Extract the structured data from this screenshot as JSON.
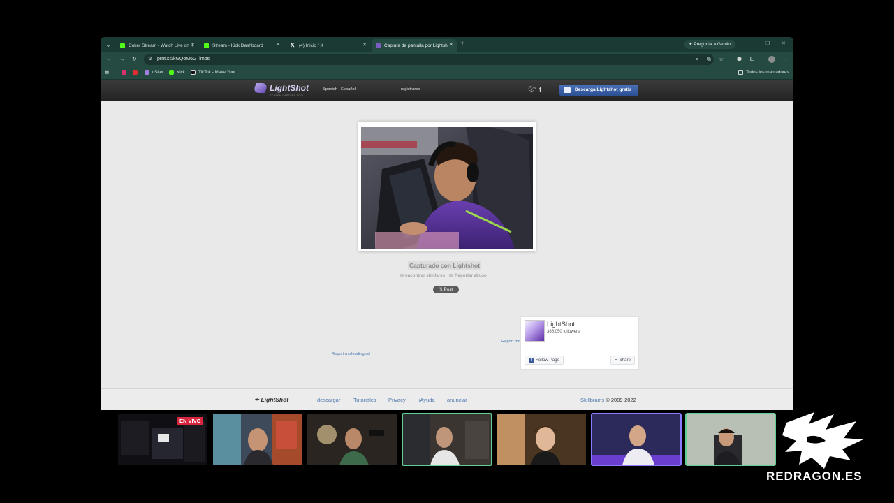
{
  "browser": {
    "tabs": [
      {
        "label": "Coker Stream - Watch Live on K",
        "favicon": "kick-icon",
        "active": false
      },
      {
        "label": "Stream - Kick Dashboard",
        "favicon": "kick-icon",
        "active": false
      },
      {
        "label": "(4) Inicio / X",
        "favicon": "x-icon",
        "active": false
      },
      {
        "label": "Captura de pantalla por Lightsh",
        "favicon": "lightshot-icon",
        "active": true
      }
    ],
    "gemini_label": "Pregunta a Gemini",
    "url": "prnt.sc/kGQoM6G_lmbs",
    "bookmarks": [
      "",
      "",
      "cSker",
      "Kick",
      "TikTok - Make Your..."
    ],
    "bookmarks_folder": "Todos los marcadores"
  },
  "lightshot": {
    "logo_text": "LightShot",
    "tagline": "SCREEN CAPTURE TOOL",
    "language": "Spanish - Español",
    "register": "registrarse",
    "download_button": "Descarga Lightshot gratis",
    "captured_text": "Capturado con Lightshot",
    "find_similar": "encontrar similares",
    "report_abuse": "Reportar abuso",
    "x_post": "Post",
    "report_ad_1": "Report misleading ad",
    "report_ad_2": "Report misleading ad",
    "fb": {
      "name": "LightShot",
      "followers": "385,050 followers",
      "follow": "Follow Page",
      "share": "Share"
    },
    "footer": {
      "logo": "LightShot",
      "links": [
        "descargar",
        "Tutoriales",
        "Privacy",
        "¡Ayuda",
        "anunciar"
      ],
      "company": "Skillbrains",
      "copyright": "© 2009-2022"
    }
  },
  "overlay": {
    "live_badge": "EN VIVO",
    "brand": "REDRAGON.ES"
  },
  "colors": {
    "tabstrip": "#1c3a34",
    "toolbar": "#254a42",
    "ls_header": "#2b2b2b",
    "download_button": "#3a62a8",
    "link": "#4f79ad",
    "cam_highlight": "#5fcf93",
    "live_red": "#d9263f"
  }
}
